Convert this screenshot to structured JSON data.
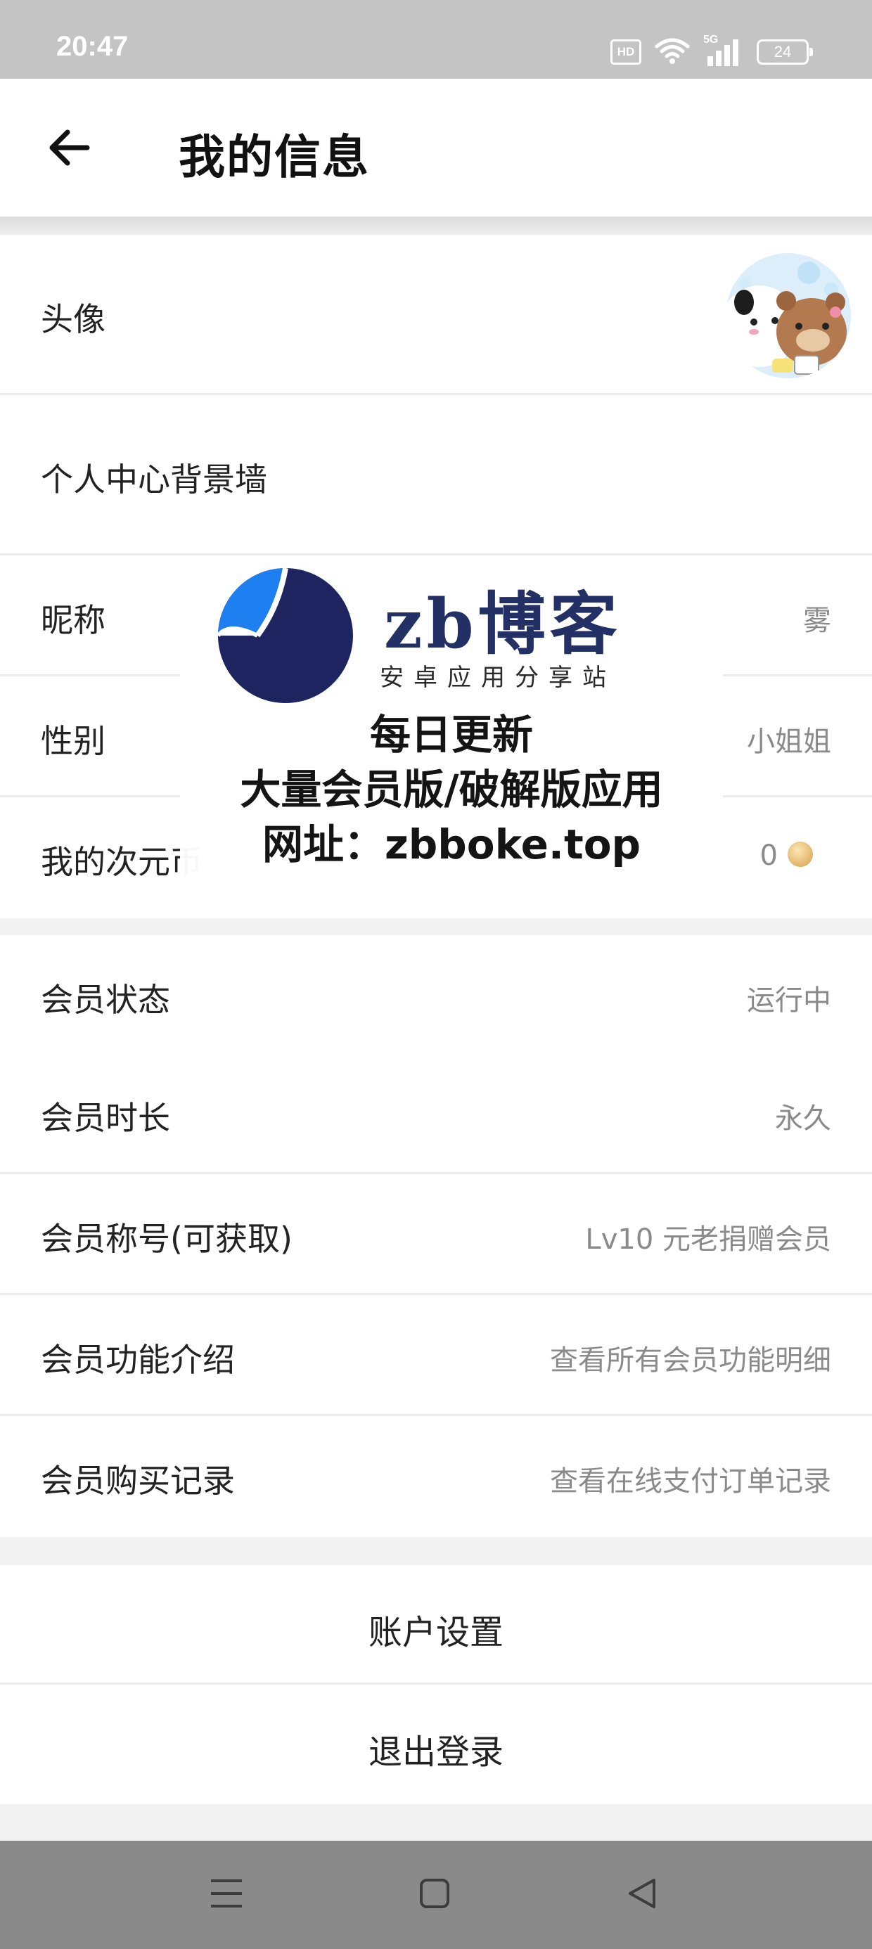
{
  "status_bar": {
    "time": "20:47",
    "hd_label": "HD",
    "network_label": "5G",
    "battery_level": "24"
  },
  "header": {
    "title": "我的信息",
    "back_icon": "arrow-left-icon"
  },
  "profile": {
    "avatar_label": "头像",
    "background_label": "个人中心背景墙",
    "nickname_label": "昵称",
    "nickname_value": "雾",
    "gender_label": "性别",
    "gender_value": "小姐姐",
    "coins_label": "我的次元币",
    "coins_value": "0"
  },
  "membership": {
    "status_label": "会员状态",
    "status_value": "运行中",
    "duration_label": "会员时长",
    "duration_value": "永久",
    "title_label": "会员称号(可获取)",
    "title_value": "Lv10 元老捐赠会员",
    "features_label": "会员功能介绍",
    "features_value": "查看所有会员功能明细",
    "purchases_label": "会员购买记录",
    "purchases_value": "查看在线支付订单记录"
  },
  "account": {
    "settings_label": "账户设置",
    "logout_label": "退出登录"
  },
  "watermark": {
    "brand": "zb博客",
    "subtitle": "安卓应用分享站",
    "line1": "每日更新",
    "line2": "大量会员版/破解版应用",
    "line3": "网址：zbboke.top"
  },
  "nav_bar": {
    "menu_icon": "menu-icon",
    "home_icon": "home-square-icon",
    "back_icon": "back-triangle-icon"
  },
  "colors": {
    "status_bar": "#c4c4c4",
    "nav_bar": "#8a8a8a",
    "background": "#f2f2f2",
    "value_text": "#8a8a8a",
    "brand_dark": "#233066",
    "brand_blue": "#1e7ff0"
  }
}
